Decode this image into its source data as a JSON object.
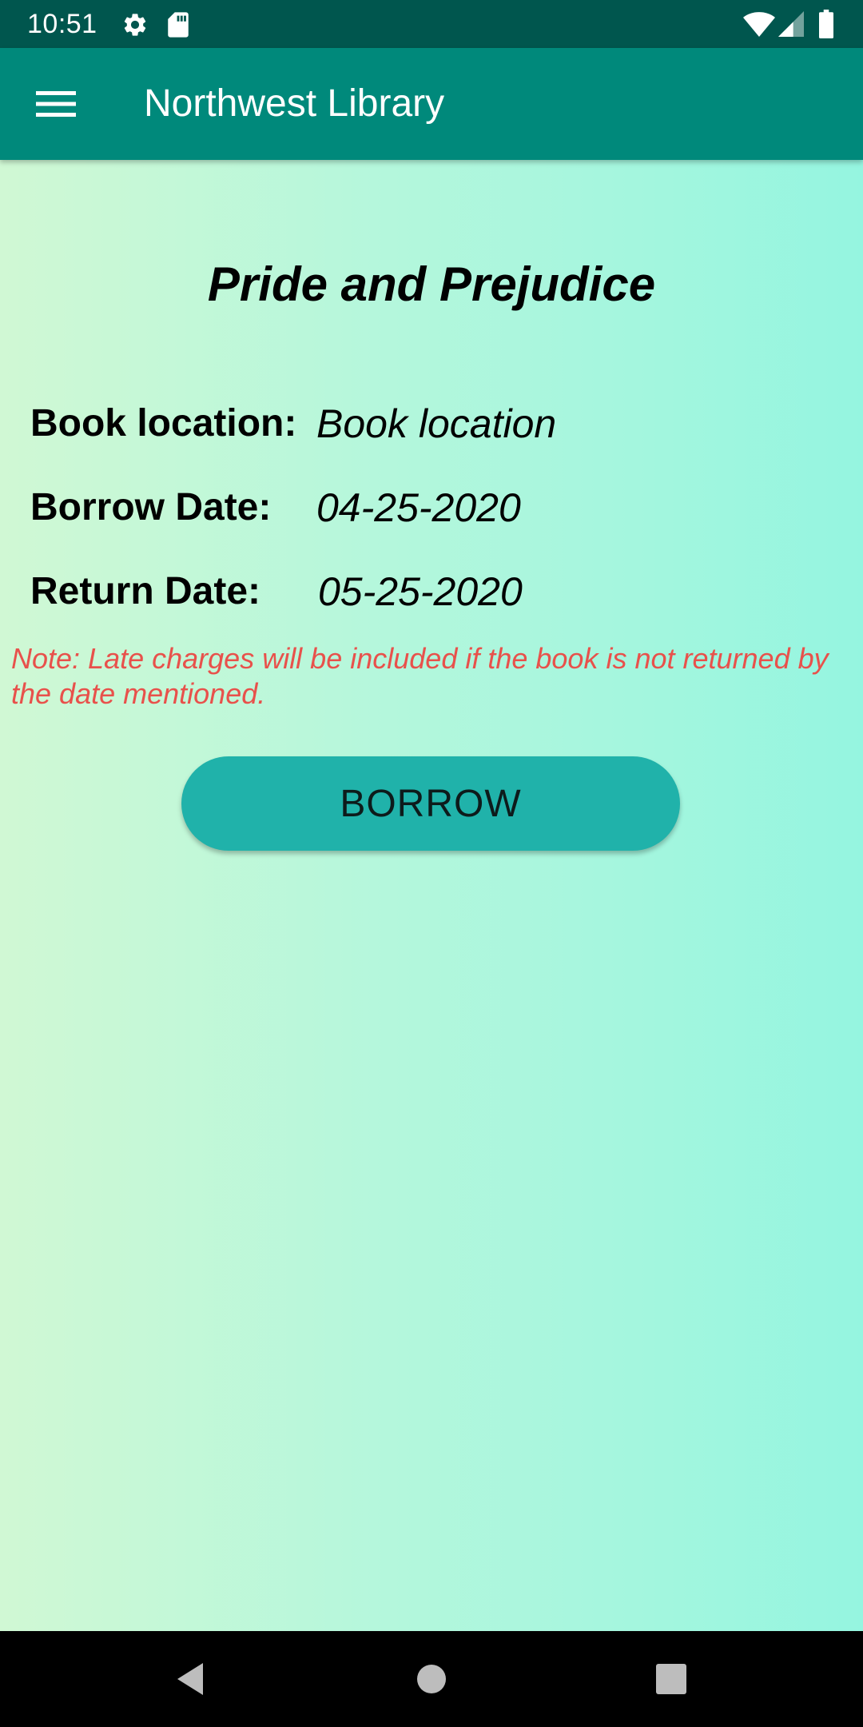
{
  "status_bar": {
    "time": "10:51",
    "icons": [
      "gear-icon",
      "sd-card-icon",
      "wifi-icon",
      "signal-icon",
      "battery-icon"
    ]
  },
  "app_bar": {
    "menu_icon": "hamburger-menu-icon",
    "title": "Northwest Library"
  },
  "book": {
    "title": "Pride and Prejudice",
    "fields": [
      {
        "label": "Book location:",
        "value": "Book location"
      },
      {
        "label": "Borrow Date:",
        "value": "04-25-2020"
      },
      {
        "label": "Return Date:",
        "value": "05-25-2020"
      }
    ],
    "note": "Note: Late charges will be included if the book is not returned by the date mentioned."
  },
  "actions": {
    "borrow_label": "BORROW"
  },
  "nav_bar": {
    "icons": [
      "back-icon",
      "home-icon",
      "recents-icon"
    ]
  },
  "colors": {
    "status_bar": "#00564e",
    "app_bar": "#00897b",
    "button": "#20b2aa",
    "note_text": "#e8514b",
    "gradient_start": "#d0f8d4",
    "gradient_end": "#95f5e0"
  }
}
